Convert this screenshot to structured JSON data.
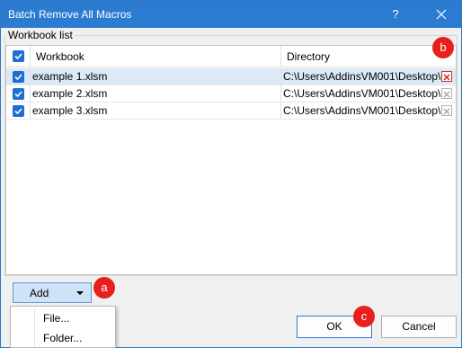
{
  "window": {
    "title": "Batch Remove All Macros",
    "help_glyph": "?"
  },
  "group": {
    "label": "Workbook list"
  },
  "columns": {
    "workbook": "Workbook",
    "directory": "Directory"
  },
  "rows": [
    {
      "checked": true,
      "workbook": "example 1.xlsm",
      "directory": "C:\\Users\\AddinsVM001\\Desktop\\"
    },
    {
      "checked": true,
      "workbook": "example 2.xlsm",
      "directory": "C:\\Users\\AddinsVM001\\Desktop\\"
    },
    {
      "checked": true,
      "workbook": "example 3.xlsm",
      "directory": "C:\\Users\\AddinsVM001\\Desktop\\"
    }
  ],
  "add_button": {
    "label": "Add"
  },
  "add_menu": [
    {
      "label": "File..."
    },
    {
      "label": "Folder..."
    }
  ],
  "footer": {
    "ok_label": "OK",
    "cancel_label": "Cancel"
  },
  "annotations": {
    "a": "a",
    "b": "b",
    "c": "c"
  },
  "colors": {
    "titlebar": "#2b7bd0",
    "accent": "#1e6fd0",
    "badge": "#e8201b",
    "selected_row": "#dce9f7"
  }
}
